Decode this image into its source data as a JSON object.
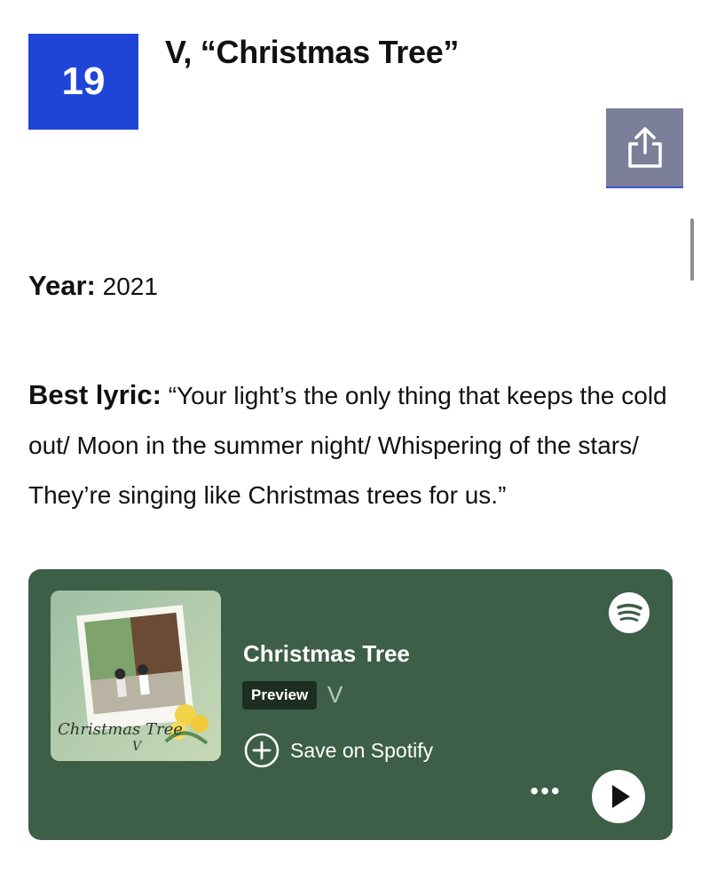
{
  "entry": {
    "rank": "19",
    "title": "V, “Christmas Tree”"
  },
  "details": {
    "year_label": "Year:",
    "year_value": "2021",
    "lyric_label": "Best lyric:",
    "lyric_text": "“Your light’s the only thing that keeps the cold out/ Moon in the summer night/ Whispering of the stars/ They’re singing like Christmas trees for us.”"
  },
  "spotify": {
    "song_title": "Christmas Tree",
    "preview_label": "Preview",
    "artist": "V",
    "save_label": "Save on Spotify",
    "album_art_text": "Christmas Tree",
    "album_art_artist": "V",
    "more_label": "•••",
    "card_color": "#3d5e47"
  },
  "colors": {
    "rank_badge": "#1f45d6",
    "share_button": "#7b7f9a"
  },
  "icons": [
    "share-icon",
    "spotify-logo-icon",
    "plus-circle-icon",
    "more-icon",
    "play-icon"
  ]
}
